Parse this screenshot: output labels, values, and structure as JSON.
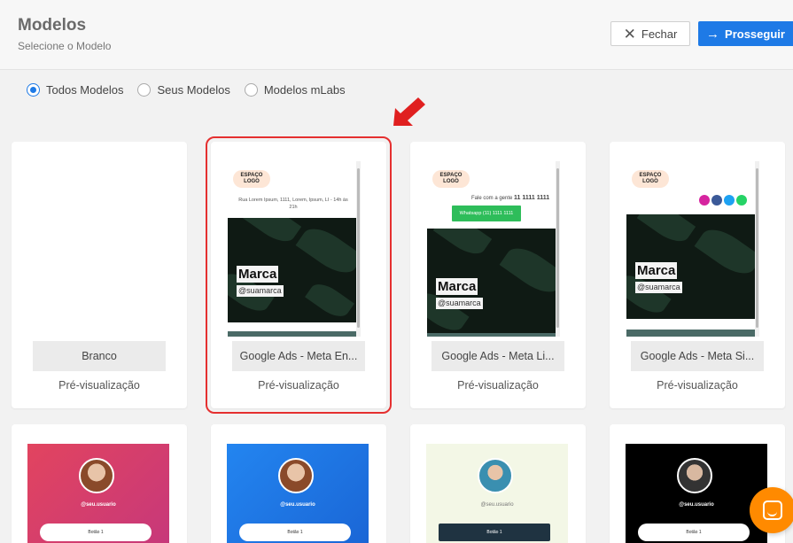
{
  "header": {
    "title": "Modelos",
    "subtitle": "Selecione o Modelo",
    "close_label": "Fechar",
    "next_label": "Prosseguir"
  },
  "filters": [
    {
      "label": "Todos Modelos",
      "selected": true
    },
    {
      "label": "Seus Modelos",
      "selected": false
    },
    {
      "label": "Modelos mLabs",
      "selected": false
    }
  ],
  "preview_label": "Pré-visualização",
  "cards": [
    {
      "name": "Branco"
    },
    {
      "name": "Google Ads - Meta En..."
    },
    {
      "name": "Google Ads - Meta Li..."
    },
    {
      "name": "Google Ads - Meta Si..."
    }
  ],
  "thumb_text": {
    "logo": "ESPAÇO LOGO",
    "address": "Rua Lorem Ipsum, 1111, Lorem, Ipsum, LI - 14h às 21h",
    "contact_text": "Fale com a gente",
    "contact_number": "11 1111 1111",
    "whatsapp": "Whatsapp (11) 1111 1111",
    "brand": "Marca",
    "handle": "@suamarca"
  },
  "profile_cards": [
    {
      "username": "@seu.usuario",
      "button": "Botão 1",
      "bg": "#d84a6a",
      "btn_bg": "#ffffff",
      "btn_color": "#333333"
    },
    {
      "username": "@seu.usuario",
      "button": "Botão 1",
      "bg": "#1e7ae6",
      "btn_bg": "#ffffff",
      "btn_color": "#333333"
    },
    {
      "username": "@seu.usuario",
      "button": "Botão 1",
      "bg": "#f3f7e6",
      "btn_bg": "#1f3341",
      "btn_color": "#ffffff"
    },
    {
      "username": "@seu.usuario",
      "button": "Botão 1",
      "bg": "#000000",
      "btn_bg": "#ffffff",
      "btn_color": "#333333"
    }
  ],
  "colors": {
    "accent": "#1e7ae6",
    "selection": "#e53030",
    "chat": "#ff8a00"
  },
  "icons": {
    "close": "close-icon",
    "next": "arrow-right-icon",
    "pointer": "pointer-arrow-icon",
    "chat": "chat-icon"
  }
}
